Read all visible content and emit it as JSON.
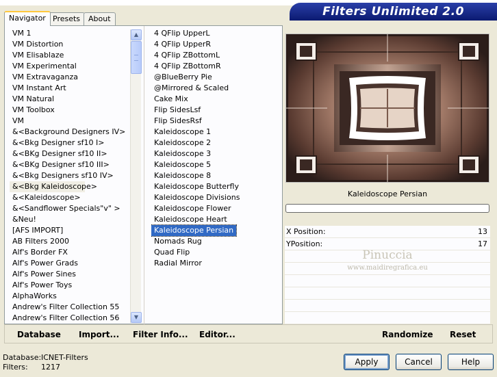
{
  "title": "Filters Unlimited 2.0",
  "tabs": [
    "Navigator",
    "Presets",
    "About"
  ],
  "categories": [
    "VM 1",
    "VM Distortion",
    "VM Elisablaze",
    "VM Experimental",
    "VM Extravaganza",
    "VM Instant Art",
    "VM Natural",
    "VM Toolbox",
    "VM",
    "&<Background Designers IV>",
    "&<Bkg Designer sf10 I>",
    "&<BKg Designer sf10 II>",
    "&<BKg Designer sf10 III>",
    "&<Bkg Designers sf10 IV>",
    "&<Bkg Kaleidoscope>",
    "&<Kaleidoscope>",
    "&<Sandflower Specials\"v\" >",
    "&Neu!",
    "[AFS IMPORT]",
    "AB Filters 2000",
    "Alf's Border FX",
    "Alf's Power Grads",
    "Alf's Power Sines",
    "Alf's Power Toys",
    "AlphaWorks",
    "Andrew's Filter Collection 55",
    "Andrew's Filter Collection 56"
  ],
  "selected_category_index": 14,
  "filters": [
    "4 QFlip UpperL",
    "4 QFlip UpperR",
    "4 QFlip ZBottomL",
    "4 QFlip ZBottomR",
    "@BlueBerry Pie",
    "@Mirrored & Scaled",
    "Cake Mix",
    "Flip SidesLsf",
    "Flip SidesRsf",
    "Kaleidoscope 1",
    "Kaleidoscope 2",
    "Kaleidoscope 3",
    "Kaleidoscope 5",
    "Kaleidoscope 8",
    "Kaleidoscope Butterfly",
    "Kaleidoscope Divisions",
    "Kaleidoscope Flower",
    "Kaleidoscope Heart",
    "Kaleidoscope Persian",
    "Nomads Rug",
    "Quad Flip",
    "Radial Mirror"
  ],
  "selected_filter_index": 18,
  "filter_name": "Kaleidoscope Persian",
  "params": [
    {
      "label": "X Position:",
      "value": "13"
    },
    {
      "label": "YPosition:",
      "value": "17"
    }
  ],
  "watermark": {
    "line1": "Pinuccia",
    "line2": "www.maidiregrafica.eu"
  },
  "toolbar": {
    "database": "Database",
    "import": "Import...",
    "filter_info": "Filter Info...",
    "editor": "Editor...",
    "randomize": "Randomize",
    "reset": "Reset"
  },
  "status": {
    "database_label": "Database:",
    "database_value": "ICNET-Filters",
    "filters_label": "Filters:",
    "filters_value": "1217"
  },
  "buttons": {
    "apply": "Apply",
    "cancel": "Cancel",
    "help": "Help"
  },
  "colors": {
    "selection": "#316ac5",
    "banner": "#0b1a70",
    "tab_accent": "#ffc83c"
  }
}
